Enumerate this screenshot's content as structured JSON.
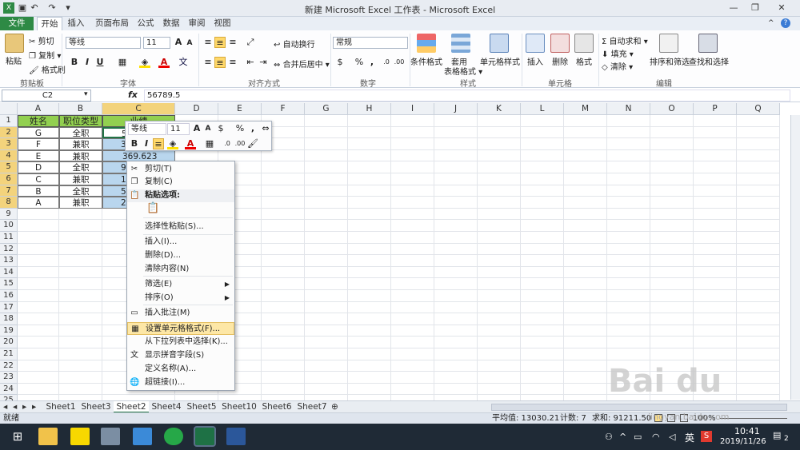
{
  "title": "新建 Microsoft Excel 工作表 - Microsoft Excel",
  "tabs": [
    "文件",
    "开始",
    "插入",
    "页面布局",
    "公式",
    "数据",
    "审阅",
    "视图"
  ],
  "clipboard": {
    "paste": "粘贴",
    "cut": "剪切",
    "copy": "复制",
    "format_painter": "格式刷",
    "group": "剪贴板"
  },
  "font": {
    "name": "等线",
    "size": "11",
    "group": "字体",
    "bold": "B",
    "italic": "I",
    "underline": "U",
    "font_color": "A"
  },
  "align": {
    "wrap": "自动换行",
    "merge": "合并后居中",
    "group": "对齐方式"
  },
  "number": {
    "format": "常规",
    "percent": "%",
    "comma": ",",
    "group": "数字"
  },
  "styles": {
    "conditional": "条件格式",
    "table": "套用\n表格格式",
    "cell": "单元格样式",
    "group": "样式"
  },
  "cells": {
    "insert": "插入",
    "delete": "删除",
    "format": "格式",
    "group": "单元格"
  },
  "editing": {
    "autosum": "自动求和",
    "fill": "填充",
    "clear": "清除",
    "sort": "排序和筛选",
    "find": "查找和选择",
    "group": "编辑"
  },
  "namebox": "C2",
  "fx": "fx",
  "formula": "56789.5",
  "columns": [
    "A",
    "B",
    "C",
    "D",
    "E",
    "F",
    "G",
    "H",
    "I",
    "J",
    "K",
    "L",
    "M",
    "N",
    "O",
    "P",
    "Q"
  ],
  "rows": [
    "1",
    "2",
    "3",
    "4",
    "5",
    "6",
    "7",
    "8",
    "9",
    "10",
    "11",
    "12",
    "13",
    "14",
    "15",
    "16",
    "17",
    "18",
    "19",
    "20",
    "21",
    "22",
    "23",
    "24",
    "25"
  ],
  "table": {
    "header": [
      "姓名",
      "职位类型",
      "业绩"
    ],
    "rows": [
      [
        "G",
        "全职",
        "5"
      ],
      [
        "F",
        "兼职",
        "3"
      ],
      [
        "E",
        "兼职",
        "369.623"
      ],
      [
        "D",
        "全职",
        "9"
      ],
      [
        "C",
        "兼职",
        "1"
      ],
      [
        "B",
        "全职",
        "5"
      ],
      [
        "A",
        "兼职",
        "2"
      ]
    ]
  },
  "minitoolbar": {
    "font": "等线",
    "size": "11",
    "percent": "%",
    "comma": ","
  },
  "context_menu": [
    {
      "label": "剪切(T)",
      "icon": "scissors-icon",
      "glyph": "✂"
    },
    {
      "label": "复制(C)",
      "icon": "copy-icon",
      "glyph": "❐"
    },
    {
      "label": "粘贴选项:",
      "icon": "paste-icon",
      "glyph": "📋",
      "header": true
    },
    {
      "label": "",
      "icon": "paste-option-icon",
      "glyph": "📋",
      "paste_row": true
    },
    {
      "label": "选择性粘贴(S)...",
      "icon": "",
      "glyph": ""
    },
    {
      "label": "插入(I)...",
      "icon": "",
      "glyph": ""
    },
    {
      "label": "删除(D)...",
      "icon": "",
      "glyph": ""
    },
    {
      "label": "清除内容(N)",
      "icon": "",
      "glyph": ""
    },
    {
      "label": "筛选(E)",
      "icon": "",
      "glyph": "",
      "sub": true
    },
    {
      "label": "排序(O)",
      "icon": "",
      "glyph": "",
      "sub": true
    },
    {
      "label": "插入批注(M)",
      "icon": "comment-icon",
      "glyph": "▭"
    },
    {
      "label": "设置单元格格式(F)...",
      "icon": "format-cells-icon",
      "glyph": "▦",
      "hot": true
    },
    {
      "label": "从下拉列表中选择(K)...",
      "icon": "",
      "glyph": ""
    },
    {
      "label": "显示拼音字段(S)",
      "icon": "phonetic-icon",
      "glyph": "文"
    },
    {
      "label": "定义名称(A)...",
      "icon": "",
      "glyph": ""
    },
    {
      "label": "超链接(I)...",
      "icon": "hyperlink-icon",
      "glyph": "🌐"
    }
  ],
  "sheets": [
    "Sheet1",
    "Sheet3",
    "Sheet2",
    "Sheet4",
    "Sheet5",
    "Sheet10",
    "Sheet6",
    "Sheet7"
  ],
  "active_sheet": "Sheet2",
  "status": {
    "ready": "就绪",
    "average": "平均值: 13030.21",
    "count": "计数: 7",
    "sum": "求和: 91211.50",
    "zoom": "100%"
  },
  "taskbar": {
    "time": "10:41",
    "date": "2019/11/26",
    "ime": "英",
    "notif": "2"
  },
  "watermark": "jingyan.baidu.com"
}
